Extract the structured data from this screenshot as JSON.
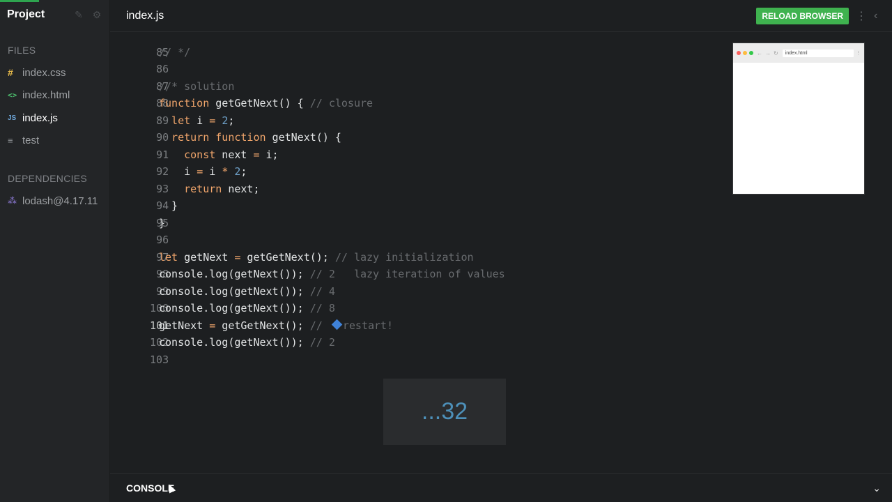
{
  "sidebar": {
    "title": "Project",
    "edit_icon": "pencil-icon",
    "settings_icon": "gear-icon",
    "files_label": "FILES",
    "files": [
      {
        "icon": "#",
        "label": "index.css"
      },
      {
        "icon": "<>",
        "label": "index.html"
      },
      {
        "icon": "JS",
        "label": "index.js"
      },
      {
        "icon": "≡",
        "label": "test"
      }
    ],
    "deps_label": "DEPENDENCIES",
    "deps": [
      {
        "label": "lodash@4.17.11"
      }
    ]
  },
  "header": {
    "file_title": "index.js",
    "reload_label": "RELOAD BROWSER",
    "menu_icon": "kebab-icon",
    "collapse_icon": "chevron-left-icon"
  },
  "editor": {
    "lines": [
      {
        "n": "85"
      },
      {
        "n": "86",
        "text": "// */"
      },
      {
        "n": "87"
      },
      {
        "n": "88",
        "text": "//* solution"
      },
      {
        "n": "89",
        "t1": "function",
        "t2": " getGetNext() { ",
        "t3": "// closure"
      },
      {
        "n": "90",
        "t1": "  let",
        "t2": " i ",
        "t3": "=",
        "t4": " ",
        "t5": "2",
        "t6": ";"
      },
      {
        "n": "91",
        "t1": "  return function",
        "t2": " getNext() {"
      },
      {
        "n": "92",
        "t1": "    const",
        "t2": " next ",
        "t3": "=",
        "t4": " i;"
      },
      {
        "n": "93",
        "t1": "    i ",
        "t2": "=",
        "t3": " i ",
        "t4": "*",
        "t5": " ",
        "t6": "2",
        "t7": ";"
      },
      {
        "n": "94",
        "t1": "    return",
        "t2": " next;"
      },
      {
        "n": "95",
        "text": "  }"
      },
      {
        "n": "96",
        "text": "}"
      },
      {
        "n": "97"
      },
      {
        "n": "98",
        "t1": "let",
        "t2": " getNext ",
        "t3": "=",
        "t4": " getGetNext(); ",
        "t5": "// lazy initialization"
      },
      {
        "n": "99",
        "t1": "console.log(getNext()); ",
        "t2": "// 2   lazy iteration of values"
      },
      {
        "n": "100",
        "t1": "console.log(getNext()); ",
        "t2": "// 4"
      },
      {
        "n": "101",
        "t1": "console.log(getNext()); ",
        "t2": "// 8"
      },
      {
        "n": "102",
        "t1": "getNext ",
        "t2": "=",
        "t3": " getGetNext(); ",
        "t4": "// ",
        "t5": "restart!"
      },
      {
        "n": "103",
        "t1": "console.log(getNext()); ",
        "t2": "// 2"
      }
    ]
  },
  "preview": {
    "url": "index.html"
  },
  "overlay": {
    "text": "...32"
  },
  "console": {
    "label": "CONSOLE",
    "toggle_icon": "chevron-down-icon"
  }
}
